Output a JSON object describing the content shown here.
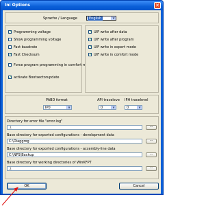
{
  "window": {
    "title": "Ini Options",
    "close_glyph": "✕"
  },
  "language": {
    "label": "Sprache / Language",
    "selected": "English"
  },
  "left_options": [
    {
      "label": "Programming voltage",
      "checked": true
    },
    {
      "label": "Show programming voltage",
      "checked": false
    },
    {
      "label": "Fast baudrate",
      "checked": false
    },
    {
      "label": "Fast Checksum",
      "checked": true
    },
    {
      "label": "Force program programming in comfort mode",
      "checked": false
    },
    {
      "label": "activate Bootsectorupdate",
      "checked": true
    }
  ],
  "right_options": [
    {
      "label": "UIF write after data",
      "checked": true
    },
    {
      "label": "UIF write after program",
      "checked": true
    },
    {
      "label": "UIF write in expert mode",
      "checked": true
    },
    {
      "label": "UIF write in comfort mode",
      "checked": true
    }
  ],
  "formats": {
    "pabd_label": "PABD format",
    "pabd_value": "IP0",
    "api_label": "API traceleve",
    "api_value": "0",
    "ifh_label": "IFH tracelevel",
    "ifh_value": "0"
  },
  "directories": [
    {
      "label": "Directory for error file \"error.log\"",
      "value": ".\\"
    },
    {
      "label": "Base directory for exported configurations - development data",
      "value": "C:\\Diaggrog"
    },
    {
      "label": "Base directory for exported configurations - accembly-line data",
      "value": "C:\\NFS\\Backup"
    },
    {
      "label": "Base directory for working directories of WinKFPT",
      "value": ".\\"
    }
  ],
  "browse_label": "...",
  "buttons": {
    "ok": "OK",
    "cancel": "Cancel"
  },
  "checkmark": "✓"
}
